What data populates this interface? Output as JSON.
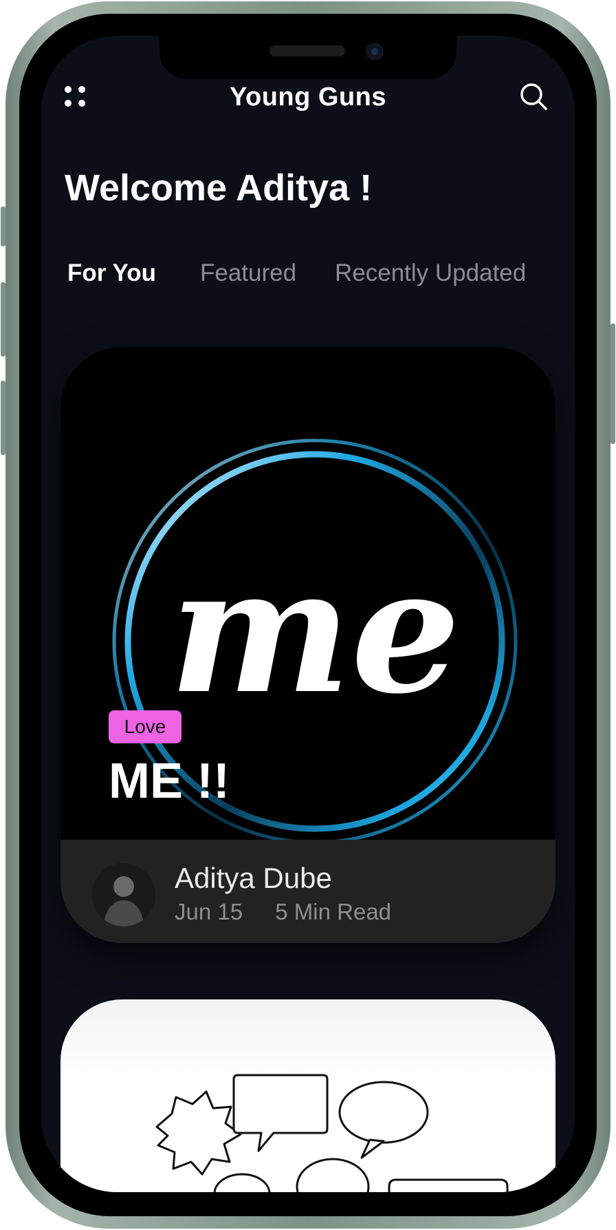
{
  "header": {
    "app_title": "Young Guns",
    "menu_icon": "grid-dots-icon",
    "search_icon": "search-icon"
  },
  "welcome": "Welcome Aditya !",
  "tabs": [
    {
      "label": "For You",
      "active": true
    },
    {
      "label": "Featured",
      "active": false
    },
    {
      "label": "Recently Updated",
      "active": false
    }
  ],
  "posts": [
    {
      "logo_text": "me",
      "tag": "Love",
      "title": "ME !!",
      "author": "Aditya Dube",
      "date": "Jun 15",
      "read_time": "5 Min Read"
    },
    {
      "image_icon": "speech-bubbles-icon"
    }
  ],
  "colors": {
    "background": "#0d0f18",
    "tag": "#ee62e4",
    "ring_blue": "#1fa9e3",
    "phone_frame": "#7d9187"
  }
}
